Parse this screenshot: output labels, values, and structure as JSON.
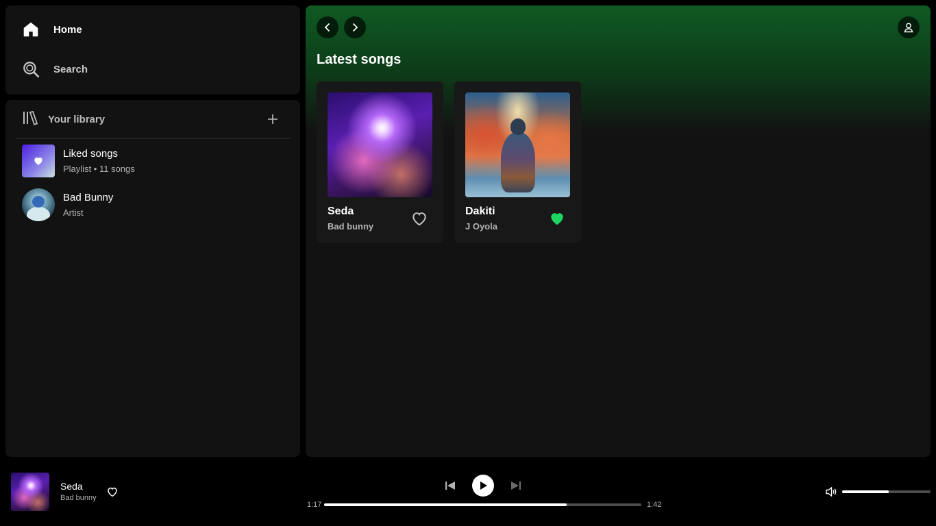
{
  "sidebar": {
    "nav": [
      {
        "label": "Home",
        "icon": "home-icon"
      },
      {
        "label": "Search",
        "icon": "search-icon"
      }
    ],
    "library": {
      "title": "Your library",
      "add_icon": "plus-icon",
      "items": [
        {
          "name": "Liked songs",
          "type": "Playlist",
          "count": "11 songs"
        },
        {
          "name": "Bad Bunny",
          "type": "Artist"
        }
      ]
    }
  },
  "main": {
    "section_title": "Latest songs",
    "cards": [
      {
        "title": "Seda",
        "artist": "Bad bunny",
        "liked": false
      },
      {
        "title": "Dakiti",
        "artist": "J Oyola",
        "liked": true
      }
    ]
  },
  "player": {
    "track": {
      "title": "Seda",
      "artist": "Bad bunny"
    },
    "elapsed": "1:17",
    "duration": "1:42",
    "progress": 0.765,
    "volume": 0.53
  },
  "colors": {
    "accent_green": "#1ed760",
    "header_green": "#0f5a23",
    "panel": "#121212",
    "card": "#181818"
  }
}
